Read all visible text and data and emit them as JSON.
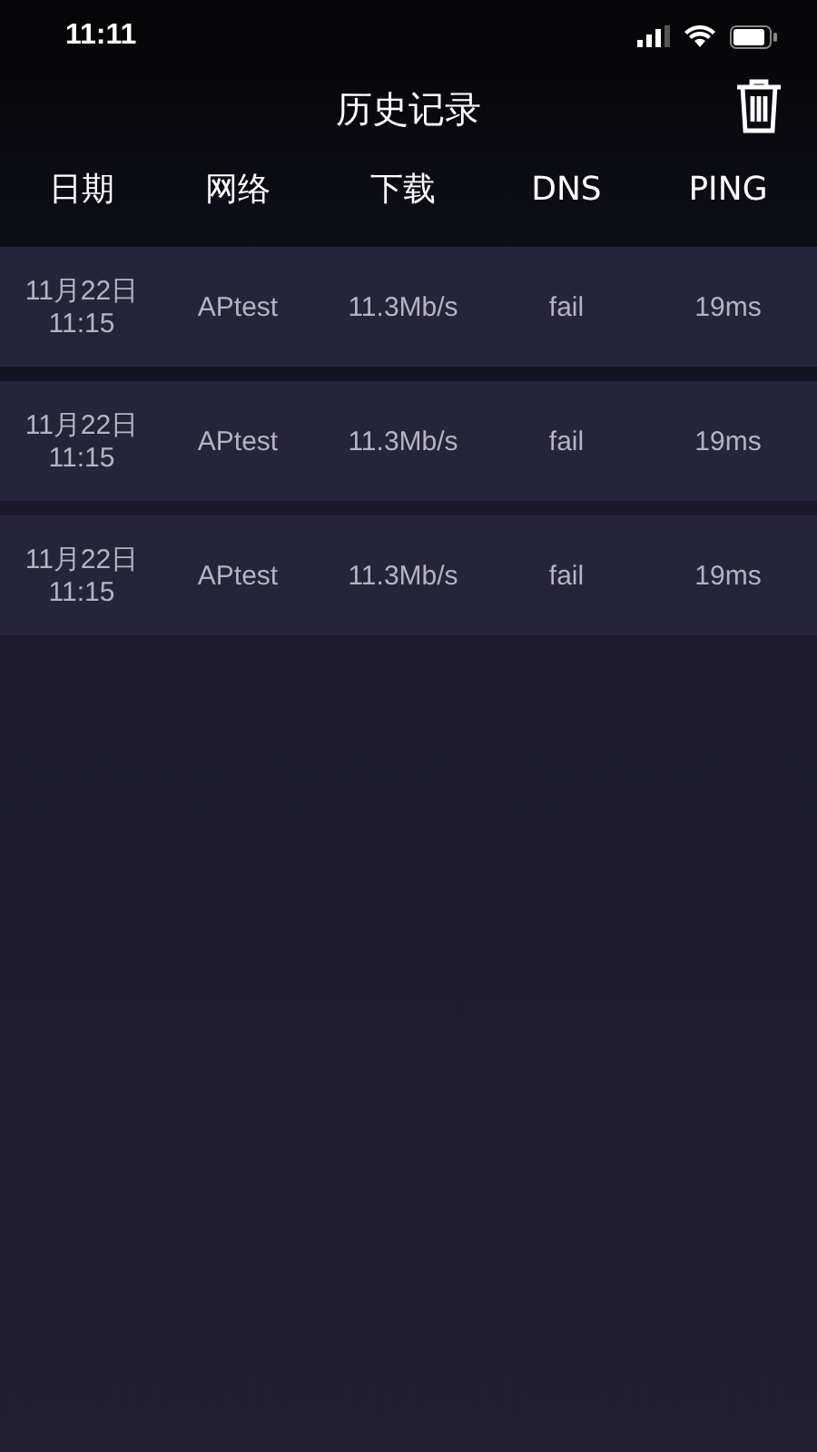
{
  "status_bar": {
    "time": "11:11"
  },
  "title_bar": {
    "title": "历史记录"
  },
  "table": {
    "columns": [
      "日期",
      "网络",
      "下载",
      "DNS",
      "PING"
    ],
    "rows": [
      {
        "date": "11月22日",
        "time": "11:15",
        "network": "APtest",
        "download": "11.3Mb/s",
        "dns": "fail",
        "ping": "19ms"
      },
      {
        "date": "11月22日",
        "time": "11:15",
        "network": "APtest",
        "download": "11.3Mb/s",
        "dns": "fail",
        "ping": "19ms"
      },
      {
        "date": "11月22日",
        "time": "11:15",
        "network": "APtest",
        "download": "11.3Mb/s",
        "dns": "fail",
        "ping": "19ms"
      }
    ]
  }
}
